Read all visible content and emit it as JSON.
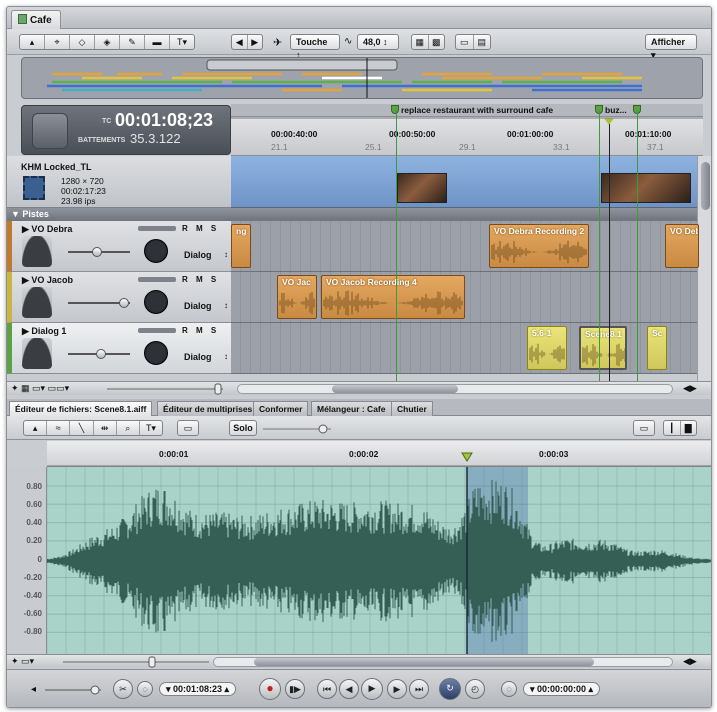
{
  "window": {
    "tab_title": "Cafe"
  },
  "toolbar": {
    "tool_icons": [
      "arrow-icon",
      "scrub-icon",
      "blade-icon",
      "range-icon",
      "pencil-icon",
      "envelope-icon",
      "text-icon"
    ],
    "snap_mode": "Touche",
    "snap_arrow": "↕",
    "value": "48,0",
    "afficher": "Afficher"
  },
  "timecode": {
    "tc_label": "TC",
    "tc": "00:01:08;23",
    "beats_label": "BATTEMENTS",
    "beats": "35.3.122"
  },
  "ruler": {
    "markers": [
      "replace restaurant with surround cafe",
      "buz..."
    ],
    "timecodes": [
      "00:00:40:00",
      "00:00:50:00",
      "00:01:00:00",
      "00:01:10:00"
    ],
    "beats": [
      "21.1",
      "25.1",
      "29.1",
      "33.1",
      "37.1"
    ]
  },
  "video": {
    "name": "KHM Locked_TL",
    "resolution": "1280 × 720",
    "duration": "00:02:17:23",
    "fps": "23.98 ips"
  },
  "pistes_label": "▼ Pistes",
  "tracks": [
    {
      "name": "▶  VO Debra",
      "rms": "R M S",
      "role": "Dialog",
      "role_arrow": "↕",
      "clips": [
        "ng",
        "VO Debra Recording 2",
        "VO Deb"
      ]
    },
    {
      "name": "▶  VO Jacob",
      "rms": "R M S",
      "role": "Dialog",
      "role_arrow": "↕",
      "clips": [
        "VO Jac",
        "VO Jacob Recording 4"
      ]
    },
    {
      "name": "▶  Dialog 1",
      "rms": "R M S",
      "role": "Dialog",
      "role_arrow": "↕",
      "clips": [
        "5.6-1",
        "Scene8.1",
        "Sc"
      ]
    }
  ],
  "editor": {
    "tabs": [
      "Éditeur de fichiers: Scene8.1.aiff",
      "Éditeur de multiprises",
      "Conformer",
      "Mélangeur : Cafe",
      "Chutier"
    ],
    "solo": "Solo",
    "ruler": [
      "0:00:01",
      "0:00:02",
      "0:00:03"
    ],
    "y_labels": [
      "0.80",
      "0.60",
      "0.40",
      "0.20",
      "0",
      "-0.20",
      "-0.40",
      "-0.60",
      "-0.80"
    ]
  },
  "transport": {
    "playhead_tc": "▾ 00:01:08:23 ▴",
    "offset_tc": "▾ 00:00:00:00 ▴",
    "buttons": [
      "record",
      "play-from-start",
      "go-to-start",
      "previous-frame",
      "play",
      "next-frame",
      "go-to-end",
      "cycle",
      "loop"
    ]
  },
  "colors": {
    "orange_clip": "#d69850",
    "yellow_clip": "#ddd66a",
    "wave_bg": "#a9d2c9",
    "wave": "#355e55"
  }
}
